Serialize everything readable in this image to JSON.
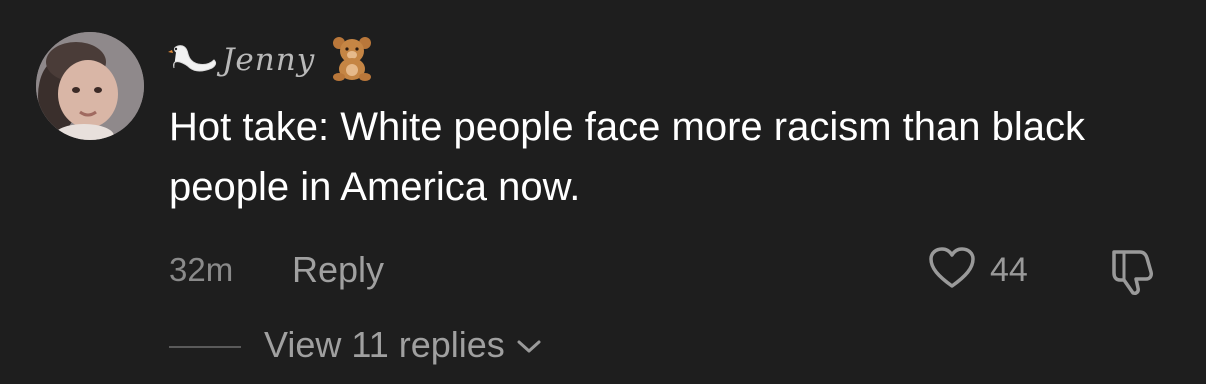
{
  "comment": {
    "author": "Jenny",
    "author_prefix_icon": "swan-emoji-icon",
    "author_suffix_icon": "teddy-bear-emoji-icon",
    "text": "Hot take: White people face more racism than black people in America now.",
    "time": "32m",
    "reply_label": "Reply",
    "like_count": "44",
    "view_replies_label": "View 11 replies"
  },
  "colors": {
    "background": "#1e1e1e",
    "primary_text": "#ffffff",
    "secondary_text": "#9a9a9a"
  }
}
